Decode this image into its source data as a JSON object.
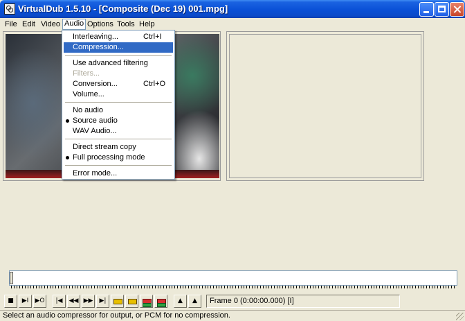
{
  "window": {
    "title": "VirtualDub 1.5.10 - [Composite (Dec 19) 001.mpg]",
    "icon": "virtualdub-film-icon"
  },
  "menubar": {
    "items": [
      {
        "label": "File"
      },
      {
        "label": "Edit"
      },
      {
        "label": "Video"
      },
      {
        "label": "Audio",
        "open": true
      },
      {
        "label": "Options"
      },
      {
        "label": "Tools"
      },
      {
        "label": "Help"
      }
    ]
  },
  "audio_menu": {
    "items": [
      {
        "label": "Interleaving...",
        "shortcut": "Ctrl+I"
      },
      {
        "label": "Compression...",
        "selected": true
      },
      {
        "label": "Use advanced filtering"
      },
      {
        "label": "Filters...",
        "disabled": true
      },
      {
        "label": "Conversion...",
        "shortcut": "Ctrl+O"
      },
      {
        "label": "Volume..."
      },
      {
        "label": "No audio"
      },
      {
        "label": "Source audio",
        "checked": true
      },
      {
        "label": "WAV Audio..."
      },
      {
        "label": "Direct stream copy"
      },
      {
        "label": "Full processing mode",
        "checked": true
      },
      {
        "label": "Error mode..."
      }
    ]
  },
  "toolbar": {
    "buttons": [
      {
        "name": "stop-icon",
        "glyph": "■"
      },
      {
        "name": "play-input-icon",
        "glyph": "▶I"
      },
      {
        "name": "play-output-icon",
        "glyph": "▶O"
      },
      {
        "name": "start-icon",
        "glyph": "|◀"
      },
      {
        "name": "back-icon",
        "glyph": "◀◀"
      },
      {
        "name": "forward-icon",
        "glyph": "▶▶"
      },
      {
        "name": "end-icon",
        "glyph": "▶|"
      },
      {
        "name": "prev-keyframe-icon",
        "glyph": ""
      },
      {
        "name": "next-keyframe-icon",
        "glyph": ""
      },
      {
        "name": "prev-scene-icon",
        "glyph": ""
      },
      {
        "name": "next-scene-icon",
        "glyph": ""
      },
      {
        "name": "mark-in-icon",
        "glyph": "▲"
      },
      {
        "name": "mark-out-icon",
        "glyph": "▲"
      }
    ],
    "frame_readout": "Frame 0 (0:00:00.000) [I]"
  },
  "status": {
    "text": "Select an audio compressor for output, or PCM for no compression."
  },
  "colors": {
    "titlebar": "#0a50d6",
    "selection": "#316ac5",
    "face": "#ece9d8"
  }
}
